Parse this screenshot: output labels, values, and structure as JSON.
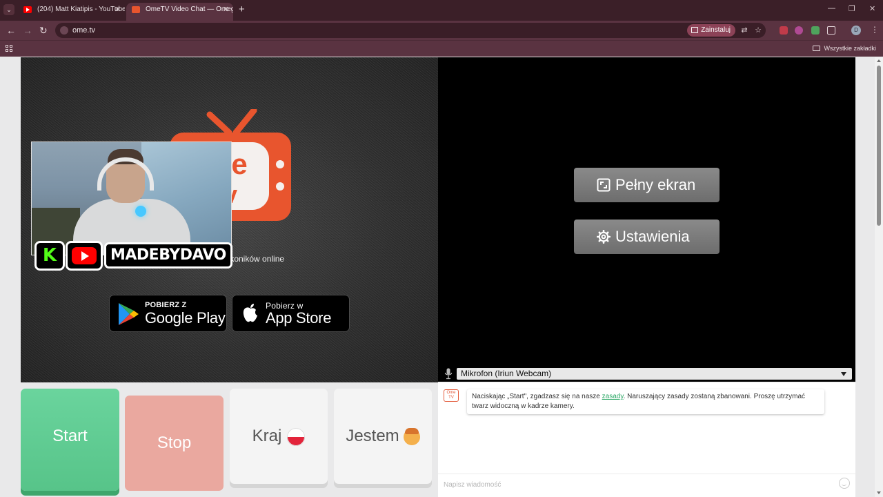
{
  "browser": {
    "tabs": [
      {
        "title": "(204) Matt Kiatipis - YouTube",
        "active": false
      },
      {
        "title": "OmeTV Video Chat — Omegle",
        "active": true
      }
    ],
    "url": "ome.tv",
    "install_label": "Zainstaluj",
    "profile_initial": "D",
    "bookmarks_label": "Wszystkie zakładki"
  },
  "left_panel": {
    "online_text": "zytkoników online",
    "google_play": {
      "small": "POBIERZ Z",
      "big": "Google Play"
    },
    "app_store": {
      "small": "Pobierz w",
      "big": "App Store"
    }
  },
  "overlay": {
    "channel_name": "MADEBYDAVO",
    "kick_letter": "K"
  },
  "right_panel": {
    "fullscreen_label": "Pełny ekran",
    "settings_label": "Ustawienia",
    "mic_selected": "Mikrofon (Iriun Webcam)"
  },
  "buttons": {
    "start": "Start",
    "stop": "Stop",
    "country": "Kraj",
    "i_am": "Jestem"
  },
  "chat": {
    "avatar_text": "Ome TV",
    "message_before": "Naciskając „Start\", zgadzasz się na nasze ",
    "message_link": "zasady",
    "message_after": ". Naruszający zasady zostaną zbanowani. Proszę utrzymać twarz widoczną w kadrze kamery.",
    "input_placeholder": "Napisz wiadomość"
  },
  "colors": {
    "browser_frame": "#5a3341",
    "start_green": "#5fcc92",
    "stop_pink": "#eaa89f",
    "link_green": "#2aa764",
    "logo_orange": "#e8552e"
  }
}
